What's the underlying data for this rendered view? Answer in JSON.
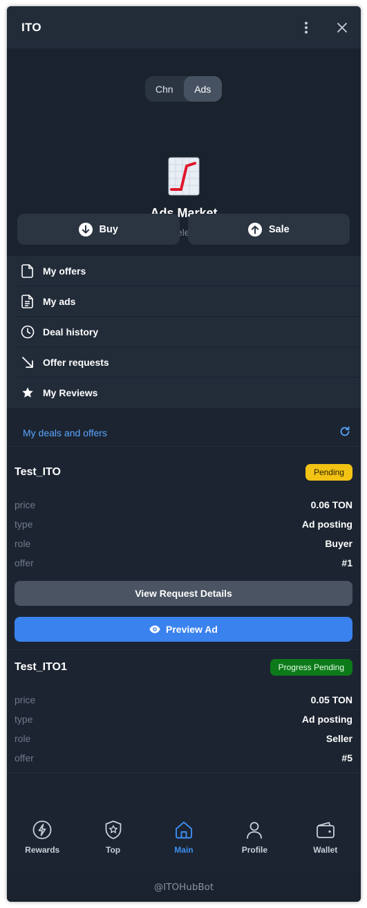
{
  "window": {
    "title": "ITO"
  },
  "segment": {
    "options": [
      "Chn",
      "Ads"
    ],
    "selected": "Ads"
  },
  "hero": {
    "title": "Ads Market",
    "subtitle": "Trading Telegram Ads"
  },
  "actions": {
    "buy": "Buy",
    "sale": "Sale"
  },
  "menu": [
    {
      "label": "My offers",
      "icon": "document-icon"
    },
    {
      "label": "My ads",
      "icon": "document-lines-icon"
    },
    {
      "label": "Deal history",
      "icon": "clock-icon"
    },
    {
      "label": "Offer requests",
      "icon": "arrow-down-right-icon"
    },
    {
      "label": "My Reviews",
      "icon": "star-icon"
    }
  ],
  "deals": {
    "header": "My deals and offers",
    "labels": {
      "price": "price",
      "type": "type",
      "role": "role",
      "offer": "offer"
    },
    "items": [
      {
        "name": "Test_ITO",
        "status": "Pending",
        "price": "0.06 TON",
        "type": "Ad posting",
        "role": "Buyer",
        "offer": "#1",
        "details_button": "View Request Details",
        "preview_button": "Preview Ad"
      },
      {
        "name": "Test_ITO1",
        "status": "Progress Pending",
        "price": "0.05 TON",
        "type": "Ad posting",
        "role": "Seller",
        "offer": "#5"
      }
    ]
  },
  "tabs": [
    {
      "label": "Rewards",
      "icon": "lightning-icon"
    },
    {
      "label": "Top",
      "icon": "shield-star-icon"
    },
    {
      "label": "Main",
      "icon": "home-icon",
      "active": true
    },
    {
      "label": "Profile",
      "icon": "user-icon"
    },
    {
      "label": "Wallet",
      "icon": "wallet-icon"
    }
  ],
  "footer": "@ITOHubBot",
  "colors": {
    "accent": "#3d8ff2",
    "link": "#5aa6ff",
    "pending": "#f2c314",
    "progress": "#0d7a1a",
    "background": "#1c2431"
  }
}
